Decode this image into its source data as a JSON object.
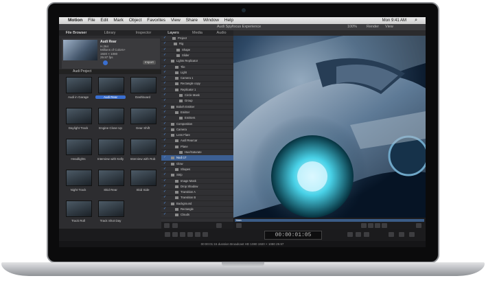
{
  "menubar": {
    "apple": "",
    "items": [
      "Motion",
      "File",
      "Edit",
      "Mark",
      "Object",
      "Favorites",
      "View",
      "Share",
      "Window",
      "Help"
    ],
    "clock": "Mon 9:41 AM",
    "search_icon": "search-icon"
  },
  "toolbar": {
    "title": "Audi Spyfocus Experience",
    "zoom": "100%",
    "render": "Render",
    "view": "View"
  },
  "left_tabs": [
    "File Browser",
    "Library",
    "Inspector"
  ],
  "right_tabs": [
    "Layers",
    "Media",
    "Audio"
  ],
  "preview": {
    "name": "Audi Rear",
    "lines": [
      "H.264",
      "Millions of Colors+",
      "1920 × 1080",
      "29.97 fps"
    ],
    "import_label": "Import"
  },
  "path_label": "Audi Project",
  "thumbnails": [
    "Audi in Garage",
    "Audi Rear",
    "Dashboard",
    "Daylight Track",
    "Engine Close Up",
    "Gear Shift",
    "Headlights",
    "Interview with Kelly",
    "Interview with Rob",
    "Night Track",
    "Skid Rear",
    "Skid Side",
    "Track Roll",
    "Track Shot Day"
  ],
  "layers": [
    "Project",
    "Rig",
    "Shape",
    "Slider",
    "Lights Replicator",
    "Tile",
    "Light",
    "Camera 1",
    "Rectangle copy",
    "Replicator 1",
    "Circle Mask",
    "Group",
    "Bokeh Emitter",
    "Emitter",
    "Emitters",
    "Composition",
    "Camera",
    "Lens Flare",
    "Audi Rearcar",
    "Plane",
    "Hue/Saturate",
    "Nodi 17",
    "Glow",
    "Shapes",
    "Strip",
    "Image Mask",
    "Drop Shadow",
    "Transition A",
    "Transition B",
    "Background",
    "Rectangle",
    "Clouds"
  ],
  "timeline_label": "Main",
  "timecode": "00:00:01:05",
  "status": "00:00:01:15 duration Broadcast HD 1080 1920 × 1080 29.97"
}
